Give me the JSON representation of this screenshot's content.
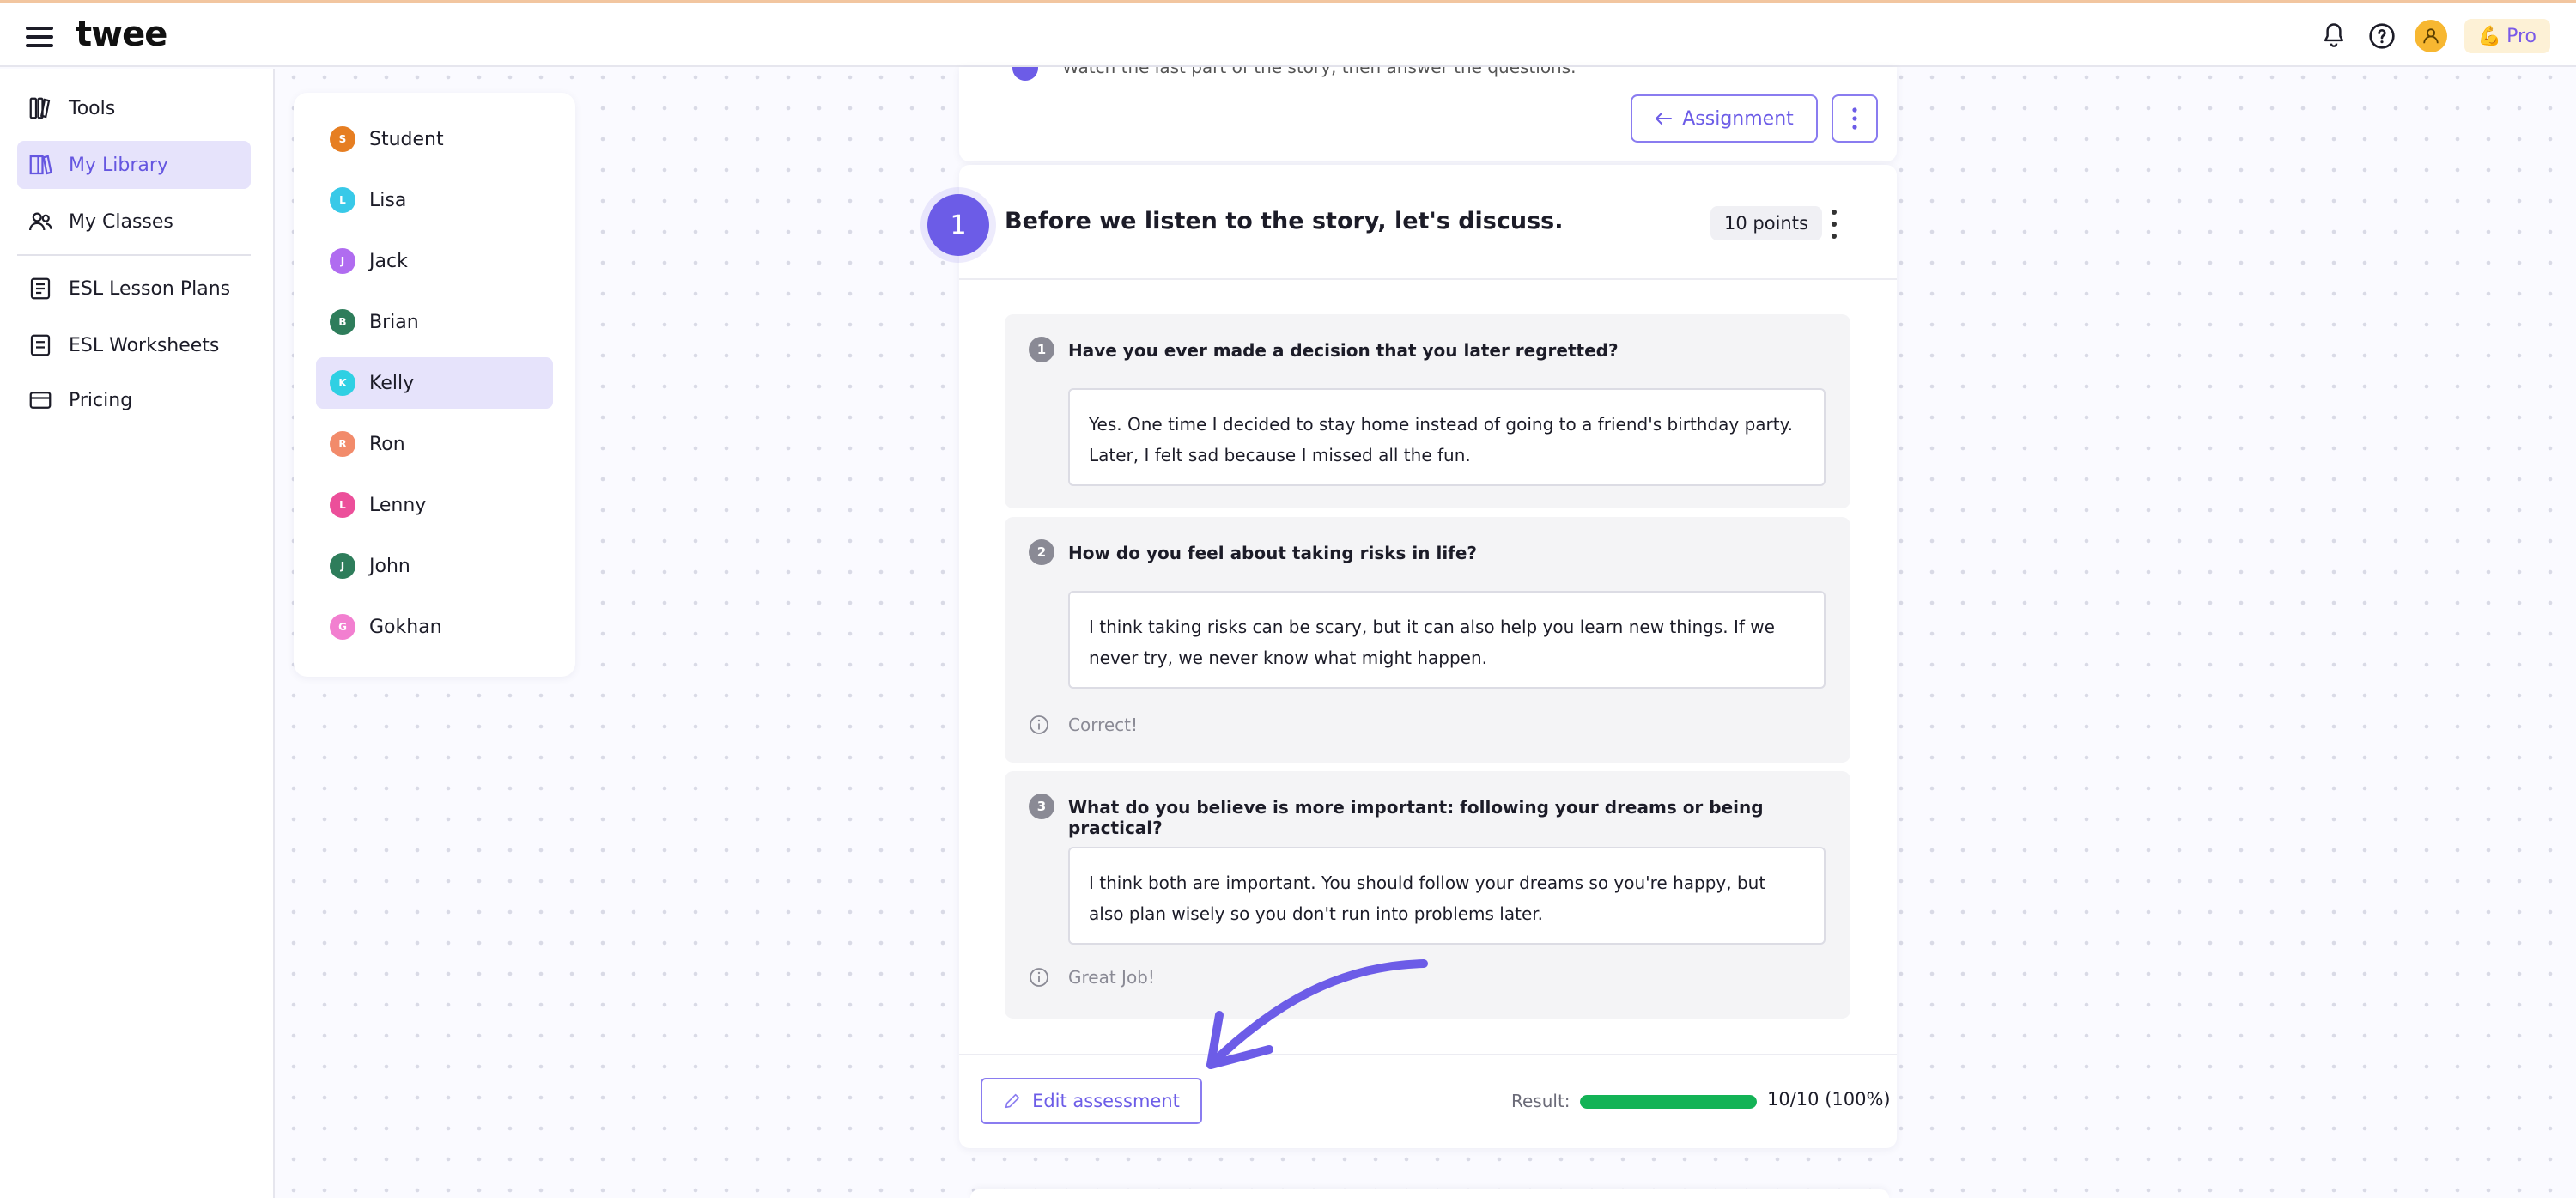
{
  "app": {
    "logo": "twee",
    "pro_label": "Pro",
    "pro_emoji": "💪"
  },
  "nav": {
    "items": [
      {
        "label": "Tools",
        "icon": "tools-icon"
      },
      {
        "label": "My Library",
        "icon": "library-icon",
        "active": true
      },
      {
        "label": "My Classes",
        "icon": "classes-icon"
      },
      {
        "label": "ESL Lesson Plans",
        "icon": "lesson-plans-icon"
      },
      {
        "label": "ESL Worksheets",
        "icon": "worksheets-icon"
      },
      {
        "label": "Pricing",
        "icon": "pricing-icon"
      }
    ]
  },
  "students": [
    {
      "initial": "S",
      "name": "Student",
      "color": "#e67e22"
    },
    {
      "initial": "L",
      "name": "Lisa",
      "color": "#38c9e8"
    },
    {
      "initial": "J",
      "name": "Jack",
      "color": "#b06cf0"
    },
    {
      "initial": "B",
      "name": "Brian",
      "color": "#2e7d5b"
    },
    {
      "initial": "K",
      "name": "Kelly",
      "color": "#2fd0e3",
      "active": true
    },
    {
      "initial": "R",
      "name": "Ron",
      "color": "#f28b6b"
    },
    {
      "initial": "L",
      "name": "Lenny",
      "color": "#ec4f9a"
    },
    {
      "initial": "J",
      "name": "John",
      "color": "#2e7d5b"
    },
    {
      "initial": "G",
      "name": "Gokhan",
      "color": "#f27fd0"
    }
  ],
  "top_card": {
    "cut_text": "Watch the last part of the story, then answer the questions.",
    "assignment_label": "Assignment"
  },
  "section": {
    "number": "1",
    "title": "Before we listen to the story, let's discuss.",
    "points": "10 points"
  },
  "questions": [
    {
      "number": "1",
      "question": "Have you ever made a decision that you later regretted?",
      "answer_lines": [
        "Yes. One time I decided to stay home instead of going to a friend's birthday party.",
        "Later, I felt sad because I missed all the fun."
      ],
      "feedback": ""
    },
    {
      "number": "2",
      "question": "How do you feel about taking risks in life?",
      "answer_lines": [
        "I think taking risks can be scary, but it can also help you learn new things. If we",
        "never try, we never know what might happen."
      ],
      "feedback": "Correct!"
    },
    {
      "number": "3",
      "question": "What do you believe is more important: following your dreams or being practical?",
      "answer_lines": [
        "I think both are important. You should follow your dreams so you're happy, but",
        "also plan wisely so you don't run into problems later."
      ],
      "feedback": "Great Job!"
    }
  ],
  "footer": {
    "edit_label": "Edit assessment",
    "result_label": "Result:",
    "result_value": "10/10 (100%)",
    "result_fraction": 1.0,
    "progress_color": "#13b356"
  }
}
